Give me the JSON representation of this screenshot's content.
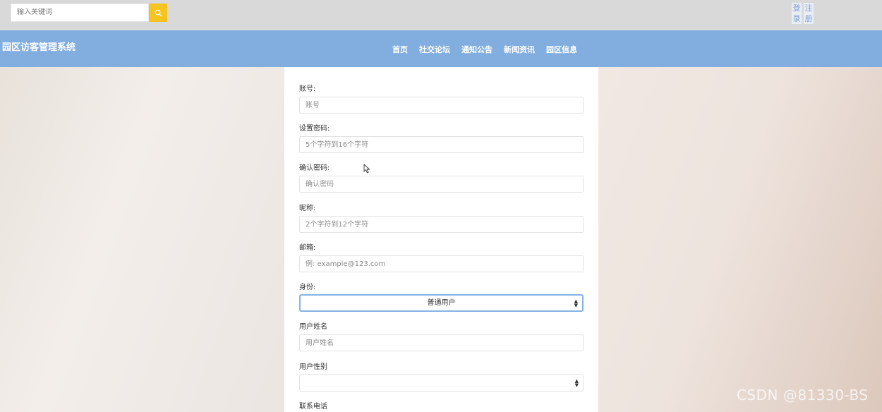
{
  "header": {
    "search": {
      "placeholder": "输入关键词"
    },
    "auth": {
      "login": "登录",
      "register": "注册"
    }
  },
  "navbar": {
    "site_title": "园区访客管理系统",
    "items": [
      "首页",
      "社交论坛",
      "通知公告",
      "新闻资讯",
      "园区信息"
    ]
  },
  "form": {
    "fields": [
      {
        "label": "账号:",
        "placeholder": "账号"
      },
      {
        "label": "设置密码:",
        "placeholder": "5个字符到16个字符"
      },
      {
        "label": "确认密码:",
        "placeholder": "确认密码"
      },
      {
        "label": "昵称:",
        "placeholder": "2个字符到12个字符"
      },
      {
        "label": "邮箱:",
        "placeholder": "例: example@123.com"
      }
    ],
    "identity": {
      "label": "身份:",
      "selected": "普通用户"
    },
    "real_name": {
      "label": "用户姓名",
      "placeholder": "用户姓名"
    },
    "gender": {
      "label": "用户性别",
      "selected": ""
    },
    "phone": {
      "label": "联系电话"
    }
  },
  "watermark": "CSDN @81330-BS"
}
